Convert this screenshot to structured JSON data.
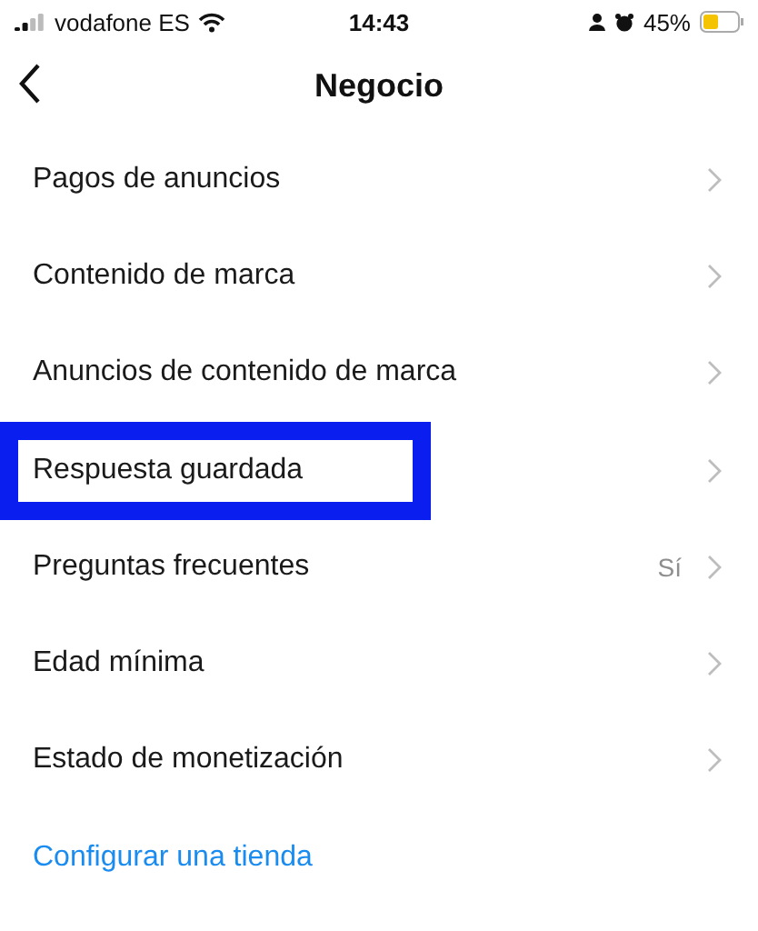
{
  "status_bar": {
    "carrier": "vodafone ES",
    "time": "14:43",
    "battery": "45%"
  },
  "header": {
    "title": "Negocio"
  },
  "items": [
    {
      "kind": "nav",
      "label": "Pagos de anuncios",
      "highlighted": false
    },
    {
      "kind": "nav",
      "label": "Contenido de marca",
      "highlighted": false
    },
    {
      "kind": "nav",
      "label": "Anuncios de contenido de marca",
      "highlighted": false
    },
    {
      "kind": "nav",
      "label": "Respuesta guardada",
      "highlighted": true
    },
    {
      "kind": "nav",
      "label": "Preguntas frecuentes",
      "value": "Sí",
      "highlighted": false
    },
    {
      "kind": "nav",
      "label": "Edad mínima",
      "highlighted": false
    },
    {
      "kind": "nav",
      "label": "Estado de monetización",
      "highlighted": false
    },
    {
      "kind": "link",
      "label": "Configurar una tienda",
      "highlighted": false
    }
  ]
}
